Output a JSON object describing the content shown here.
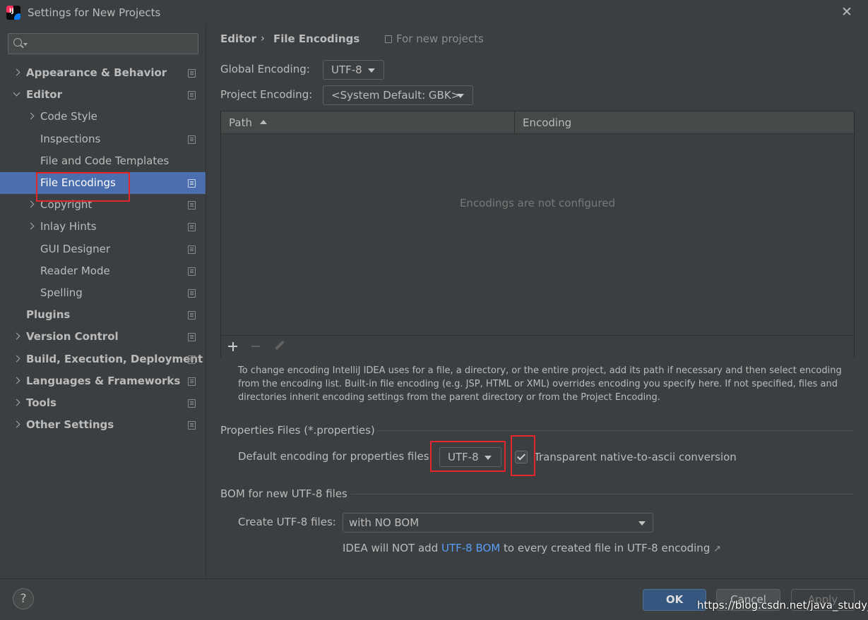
{
  "window": {
    "title": "Settings for New Projects",
    "app_icon_text": "IJ",
    "close_symbol": "✕"
  },
  "search": {
    "placeholder": ""
  },
  "sidebar": {
    "items": [
      {
        "label": "Appearance & Behavior",
        "bold": true,
        "expander": "collapsed",
        "project_icon": true
      },
      {
        "label": "Editor",
        "bold": true,
        "expander": "expanded",
        "project_icon": true
      },
      {
        "label": "Code Style",
        "bold": false,
        "expander": "collapsed",
        "project_icon": false
      },
      {
        "label": "Inspections",
        "bold": false,
        "expander": "none",
        "project_icon": true
      },
      {
        "label": "File and Code Templates",
        "bold": false,
        "expander": "none",
        "project_icon": false
      },
      {
        "label": "File Encodings",
        "bold": false,
        "expander": "none",
        "project_icon": true,
        "selected": true
      },
      {
        "label": "Copyright",
        "bold": false,
        "expander": "collapsed",
        "project_icon": true
      },
      {
        "label": "Inlay Hints",
        "bold": false,
        "expander": "collapsed",
        "project_icon": true
      },
      {
        "label": "GUI Designer",
        "bold": false,
        "expander": "none",
        "project_icon": true
      },
      {
        "label": "Reader Mode",
        "bold": false,
        "expander": "none",
        "project_icon": true
      },
      {
        "label": "Spelling",
        "bold": false,
        "expander": "none",
        "project_icon": true
      },
      {
        "label": "Plugins",
        "bold": true,
        "expander": "none",
        "project_icon": true
      },
      {
        "label": "Version Control",
        "bold": true,
        "expander": "collapsed",
        "project_icon": true
      },
      {
        "label": "Build, Execution, Deployment",
        "bold": true,
        "expander": "collapsed",
        "project_icon": true
      },
      {
        "label": "Languages & Frameworks",
        "bold": true,
        "expander": "collapsed",
        "project_icon": true
      },
      {
        "label": "Tools",
        "bold": true,
        "expander": "collapsed",
        "project_icon": true
      },
      {
        "label": "Other Settings",
        "bold": true,
        "expander": "collapsed",
        "project_icon": true
      }
    ]
  },
  "breadcrumb": {
    "parent": "Editor",
    "separator": "›",
    "current": "File Encodings",
    "scope": "For new projects"
  },
  "global_encoding": {
    "label": "Global Encoding:",
    "value": "UTF-8"
  },
  "project_encoding": {
    "label": "Project Encoding:",
    "value": "<System Default: GBK>"
  },
  "table": {
    "columns": [
      "Path",
      "Encoding"
    ],
    "rows": [],
    "empty_text": "Encodings are not configured"
  },
  "help_text": "To change encoding IntelliJ IDEA uses for a file, a directory, or the entire project, add its path if necessary and then select encoding from the encoding list. Built-in file encoding (e.g. JSP, HTML or XML) overrides encoding you specify here. If not specified, files and directories inherit encoding settings from the parent directory or from the Project Encoding.",
  "properties": {
    "section_title": "Properties Files (*.properties)",
    "default_label": "Default encoding for properties files:",
    "default_value": "UTF-8",
    "transparent_checked": true,
    "transparent_label": "Transparent native-to-ascii conversion"
  },
  "bom": {
    "section_title": "BOM for new UTF-8 files",
    "create_label": "Create UTF-8 files:",
    "create_value": "with NO BOM",
    "note_prefix": "IDEA will NOT add ",
    "note_link": "UTF-8 BOM",
    "note_suffix": " to every created file in UTF-8 encoding",
    "note_arrow": "↗"
  },
  "buttons": {
    "help": "?",
    "ok": "OK",
    "cancel": "Cancel",
    "apply": "Apply"
  },
  "watermark": "https://blog.csdn.net/java_study_",
  "colors": {
    "selection": "#4b6eaf",
    "highlight_box": "#e5262b",
    "link": "#589df6"
  }
}
